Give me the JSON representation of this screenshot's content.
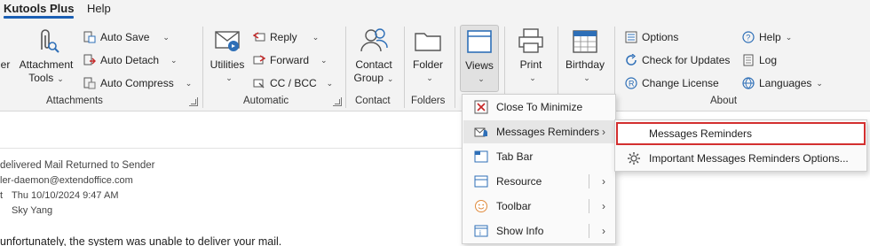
{
  "tabs": [
    {
      "label": "Kutools Plus",
      "active": true
    },
    {
      "label": "Help",
      "active": false
    }
  ],
  "ribbon": {
    "partial_left_label": "ger",
    "attachments": {
      "big": {
        "label_line1": "Attachment",
        "label_line2": "Tools"
      },
      "items": [
        "Auto Save",
        "Auto Detach",
        "Auto Compress"
      ],
      "group_label": "Attachments"
    },
    "automatic": {
      "big": {
        "label": "Utilities"
      },
      "items": [
        "Reply",
        "Forward",
        "CC / BCC"
      ],
      "group_label": "Automatic"
    },
    "contact": {
      "big": {
        "label_line1": "Contact",
        "label_line2": "Group"
      },
      "group_label": "Contact"
    },
    "folders": {
      "big": {
        "label": "Folder"
      },
      "group_label": "Folders"
    },
    "views": {
      "label": "Views"
    },
    "print": {
      "label": "Print"
    },
    "birthday": {
      "label": "Birthday"
    },
    "about": {
      "col1": [
        "Options",
        "Check for Updates",
        "Change License"
      ],
      "col2": [
        "Help",
        "Log",
        "Languages"
      ],
      "group_label": "About"
    }
  },
  "message": {
    "subject": "delivered Mail Returned to Sender",
    "from": "ler-daemon@extendoffice.com",
    "sent_prefix": "t",
    "date": "Thu 10/10/2024 9:47 AM",
    "to": "Sky Yang",
    "body": "unfortunately, the system was unable to deliver your mail."
  },
  "views_menu": [
    {
      "label": "Close To Minimize",
      "icon": "close-box-icon",
      "submenu": false
    },
    {
      "label": "Messages Reminders",
      "icon": "bell-envelope-icon",
      "submenu": true,
      "hover": true
    },
    {
      "label": "Tab Bar",
      "icon": "tab-bar-icon",
      "submenu": false
    },
    {
      "label": "Resource",
      "icon": "resource-window-icon",
      "submenu": true
    },
    {
      "label": "Toolbar",
      "icon": "smiley-icon",
      "submenu": true
    },
    {
      "label": "Show Info",
      "icon": "info-window-icon",
      "submenu": true
    }
  ],
  "reminders_submenu": [
    {
      "label": "Messages Reminders",
      "selected": true
    },
    {
      "label": "Important Messages Reminders Options...",
      "icon": "gear-icon"
    }
  ],
  "colors": {
    "accent": "#1a5fb4",
    "ribbon_bg": "#f3f3f3",
    "selection_border": "#d32f2f",
    "icon_blue": "#2e6fb7",
    "icon_red": "#c62828"
  }
}
